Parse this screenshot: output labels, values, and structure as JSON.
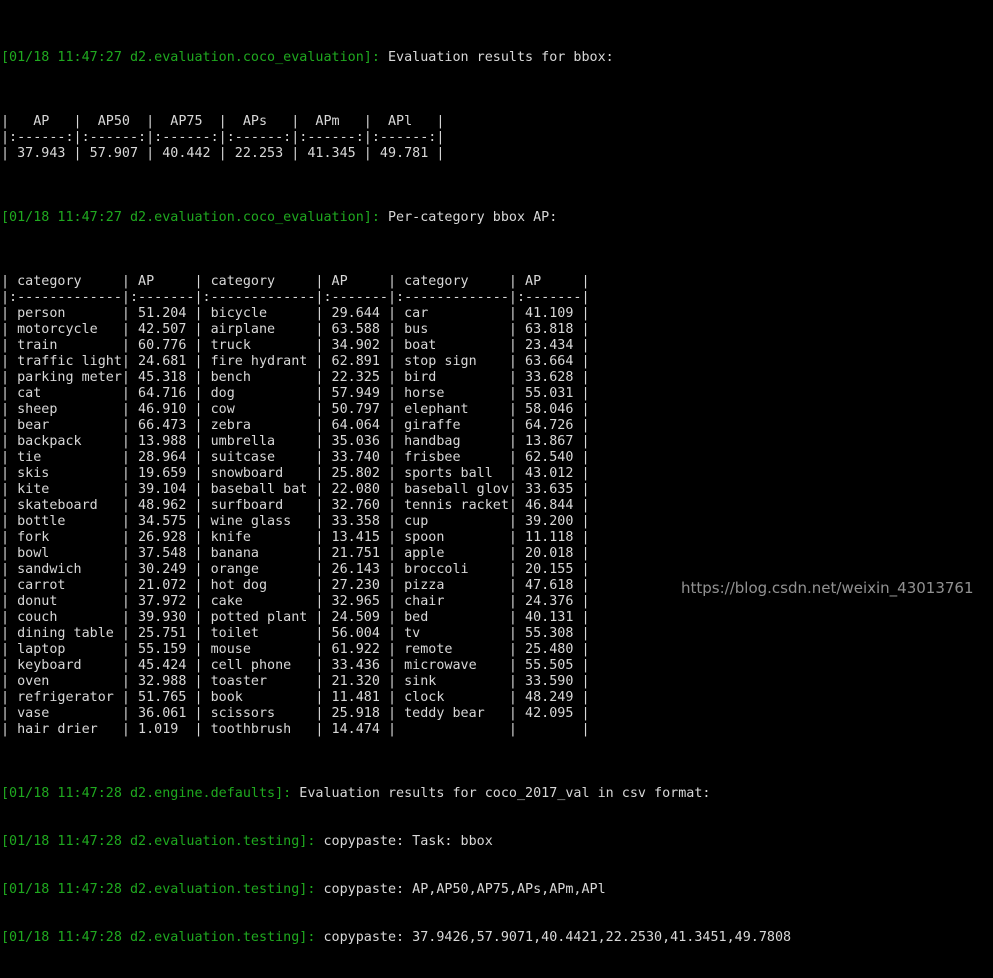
{
  "terminal": {
    "colors": {
      "background": "#000000",
      "log_prefix": "#1fa91f",
      "text": "#d8d8d8"
    },
    "watermark": "https://blog.csdn.net/weixin_43013761"
  },
  "logs": [
    {
      "prefix": "[01/18 11:47:27 d2.evaluation.coco_evaluation]:",
      "message": " Evaluation results for bbox:"
    },
    {
      "prefix": "[01/18 11:47:27 d2.evaluation.coco_evaluation]:",
      "message": " Per-category bbox AP:"
    },
    {
      "prefix": "[01/18 11:47:28 d2.engine.defaults]:",
      "message": " Evaluation results for coco_2017_val in csv format:"
    },
    {
      "prefix": "[01/18 11:47:28 d2.evaluation.testing]:",
      "message": " copypaste: Task: bbox"
    },
    {
      "prefix": "[01/18 11:47:28 d2.evaluation.testing]:",
      "message": " copypaste: AP,AP50,AP75,APs,APm,APl"
    },
    {
      "prefix": "[01/18 11:47:28 d2.evaluation.testing]:",
      "message": " copypaste: 37.9426,57.9071,40.4421,22.2530,41.3451,49.7808"
    }
  ],
  "summary_table": {
    "headers": [
      "AP",
      "AP50",
      "AP75",
      "APs",
      "APm",
      "APl"
    ],
    "separator": ":------:",
    "values": [
      "37.943",
      "57.907",
      "40.442",
      "22.253",
      "41.345",
      "49.781"
    ]
  },
  "per_category_table": {
    "headers": [
      "category",
      "AP",
      "category",
      "AP",
      "category",
      "AP"
    ],
    "separator_wide": ":-------------",
    "separator_narrow": ":-------",
    "rows": [
      [
        "person",
        "51.204",
        "bicycle",
        "29.644",
        "car",
        "41.109"
      ],
      [
        "motorcycle",
        "42.507",
        "airplane",
        "63.588",
        "bus",
        "63.818"
      ],
      [
        "train",
        "60.776",
        "truck",
        "34.902",
        "boat",
        "23.434"
      ],
      [
        "traffic light",
        "24.681",
        "fire hydrant",
        "62.891",
        "stop sign",
        "63.664"
      ],
      [
        "parking meter",
        "45.318",
        "bench",
        "22.325",
        "bird",
        "33.628"
      ],
      [
        "cat",
        "64.716",
        "dog",
        "57.949",
        "horse",
        "55.031"
      ],
      [
        "sheep",
        "46.910",
        "cow",
        "50.797",
        "elephant",
        "58.046"
      ],
      [
        "bear",
        "66.473",
        "zebra",
        "64.064",
        "giraffe",
        "64.726"
      ],
      [
        "backpack",
        "13.988",
        "umbrella",
        "35.036",
        "handbag",
        "13.867"
      ],
      [
        "tie",
        "28.964",
        "suitcase",
        "33.740",
        "frisbee",
        "62.540"
      ],
      [
        "skis",
        "19.659",
        "snowboard",
        "25.802",
        "sports ball",
        "43.012"
      ],
      [
        "kite",
        "39.104",
        "baseball bat",
        "22.080",
        "baseball glove",
        "33.635"
      ],
      [
        "skateboard",
        "48.962",
        "surfboard",
        "32.760",
        "tennis racket",
        "46.844"
      ],
      [
        "bottle",
        "34.575",
        "wine glass",
        "33.358",
        "cup",
        "39.200"
      ],
      [
        "fork",
        "26.928",
        "knife",
        "13.415",
        "spoon",
        "11.118"
      ],
      [
        "bowl",
        "37.548",
        "banana",
        "21.751",
        "apple",
        "20.018"
      ],
      [
        "sandwich",
        "30.249",
        "orange",
        "26.143",
        "broccoli",
        "20.155"
      ],
      [
        "carrot",
        "21.072",
        "hot dog",
        "27.230",
        "pizza",
        "47.618"
      ],
      [
        "donut",
        "37.972",
        "cake",
        "32.965",
        "chair",
        "24.376"
      ],
      [
        "couch",
        "39.930",
        "potted plant",
        "24.509",
        "bed",
        "40.131"
      ],
      [
        "dining table",
        "25.751",
        "toilet",
        "56.004",
        "tv",
        "55.308"
      ],
      [
        "laptop",
        "55.159",
        "mouse",
        "61.922",
        "remote",
        "25.480"
      ],
      [
        "keyboard",
        "45.424",
        "cell phone",
        "33.436",
        "microwave",
        "55.505"
      ],
      [
        "oven",
        "32.988",
        "toaster",
        "21.320",
        "sink",
        "33.590"
      ],
      [
        "refrigerator",
        "51.765",
        "book",
        "11.481",
        "clock",
        "48.249"
      ],
      [
        "vase",
        "36.061",
        "scissors",
        "25.918",
        "teddy bear",
        "42.095"
      ],
      [
        "hair drier",
        "1.019",
        "toothbrush",
        "14.474",
        "",
        ""
      ]
    ]
  }
}
